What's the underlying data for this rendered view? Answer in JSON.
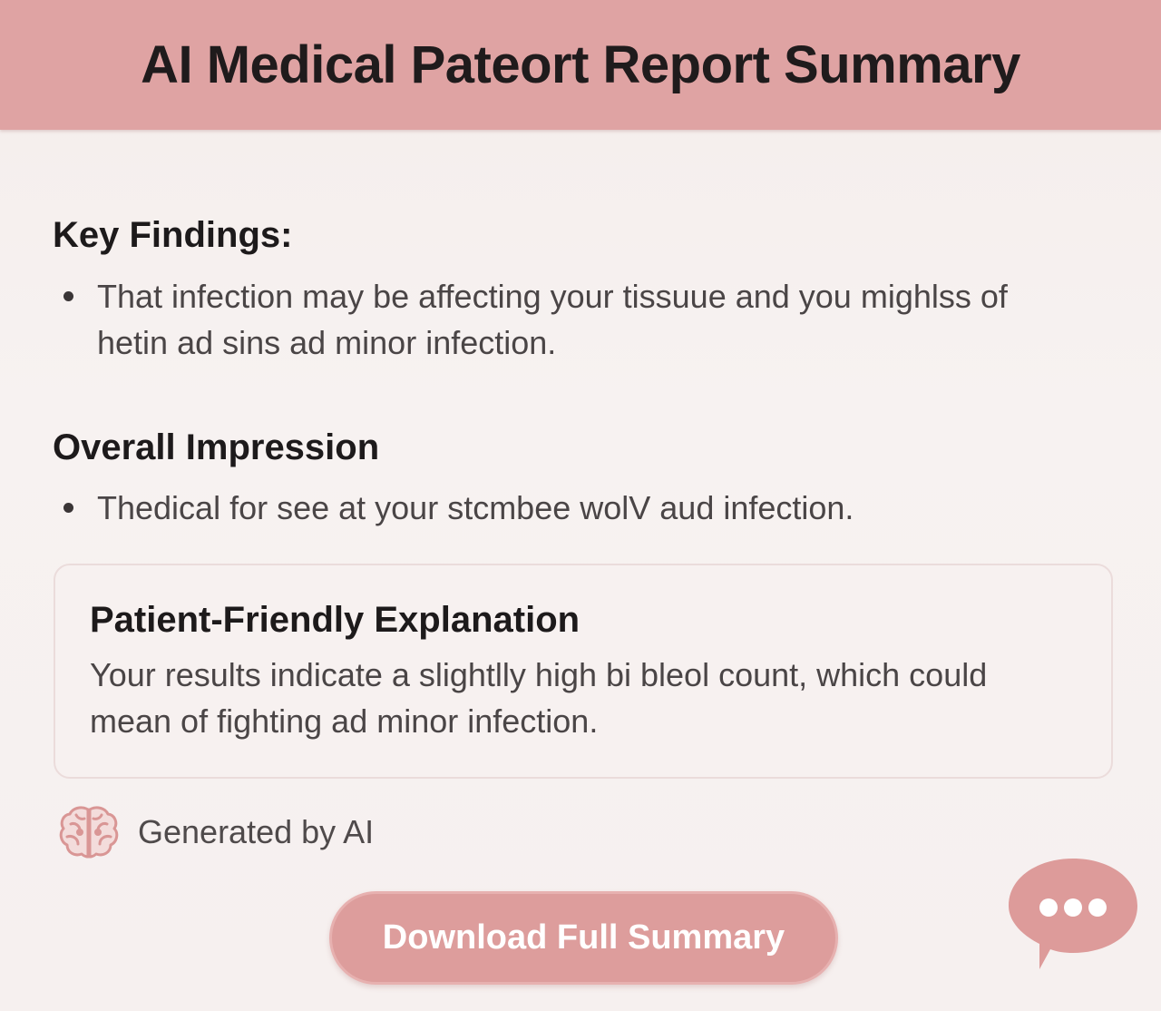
{
  "header": {
    "title": "AI Medical Pateort Report Summary"
  },
  "key_findings": {
    "title": "Key Findings:",
    "items": [
      "That infection may be affecting your tissuue and you mighlss of hetin ad sins ad minor infection."
    ]
  },
  "overall_impression": {
    "title": "Overall Impression",
    "items": [
      "Thedical for see at your stcmbee wolV aud infection."
    ]
  },
  "explanation": {
    "title": "Patient-Friendly Explanation",
    "body": "Your results indicate a slightlly high bi bleol count, which could mean of fighting ad minor infection."
  },
  "footer": {
    "generated_label": "Generated by AI",
    "generated_icon": "brain-icon",
    "download_label": "Download Full Summary",
    "chat_icon": "chat-bubble-icon"
  },
  "colors": {
    "accent": "#dfa3a3",
    "button": "#dd9d9c",
    "background": "#f5efee",
    "text_dark": "#1d1a1b",
    "text_body": "#4a4546"
  }
}
